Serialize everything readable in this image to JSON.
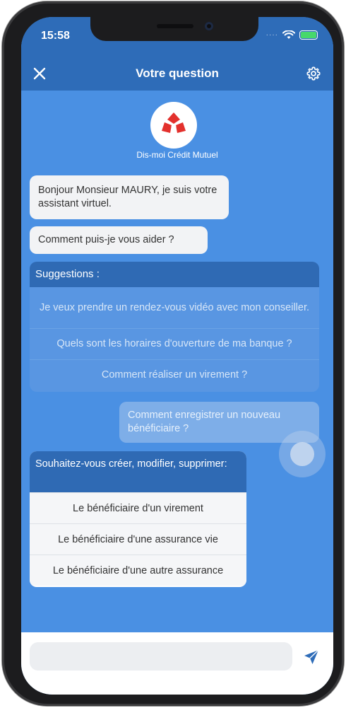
{
  "status_bar": {
    "time": "15:58"
  },
  "header": {
    "title": "Votre question"
  },
  "bot": {
    "name": "Dis-moi Crédit Mutuel"
  },
  "messages": {
    "greeting": "Bonjour Monsieur MAURY, je suis votre assistant virtuel.",
    "help": "Comment puis-je vous aider ?"
  },
  "suggestions": {
    "header": "Suggestions :",
    "items": [
      "Je veux prendre un rendez-vous vidéo avec mon conseiller.",
      "Quels sont les horaires d'ouverture de ma banque ?",
      "Comment réaliser un virement ?"
    ]
  },
  "user_message": "Comment enregistrer un nouveau bénéficiaire ?",
  "choice_card": {
    "header": "Souhaitez-vous créer, modifier, supprimer:",
    "options": [
      "Le bénéficiaire d'un virement",
      "Le bénéficiaire d'une assurance vie",
      "Le bénéficiaire d'une autre assurance"
    ]
  },
  "composer": {
    "placeholder": ""
  },
  "colors": {
    "chat_background": "#4a90e3",
    "header_blue": "#2e6cb8",
    "logo_red": "#e3312d"
  },
  "icons": {
    "close": "close-icon",
    "settings": "gear-icon",
    "send": "send-icon",
    "logo": "credit-mutuel-logo"
  }
}
